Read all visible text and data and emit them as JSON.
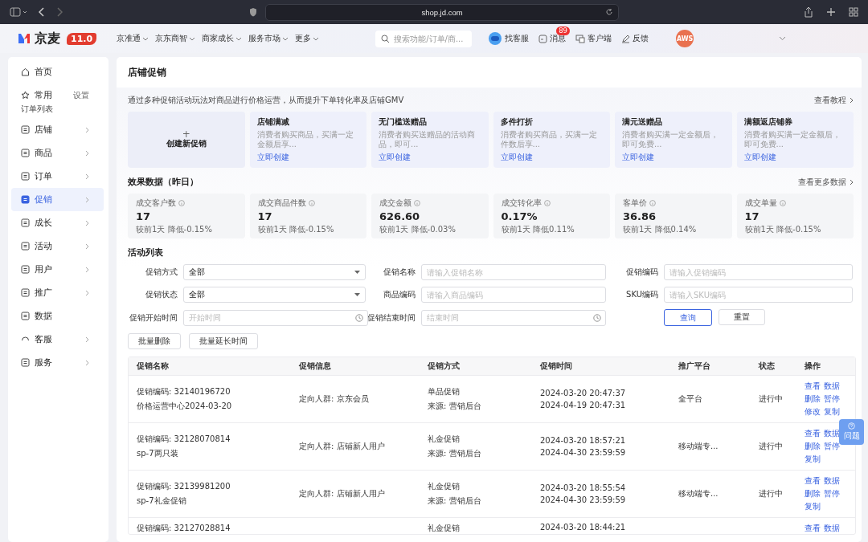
{
  "browser": {
    "url": "shop.jd.com"
  },
  "header": {
    "logo_text": "京麦",
    "version": "11.0",
    "nav": [
      "京准通",
      "京东商智",
      "商家成长",
      "服务市场",
      "更多"
    ],
    "search": {
      "placeholder": "搜索功能/订单/商..."
    },
    "tools": [
      {
        "kind": "service",
        "label": "找客服"
      },
      {
        "kind": "message",
        "label": "消息",
        "badge": "89"
      },
      {
        "kind": "client",
        "label": "客户端"
      },
      {
        "kind": "feedback",
        "label": "反馈"
      }
    ],
    "avatar_text": "AWS"
  },
  "sidebar": {
    "items": [
      {
        "kind": "home",
        "label": "首页",
        "selected": false
      },
      {
        "kind": "pinned",
        "label": "常用",
        "action": "设置",
        "selected": false
      },
      {
        "kind": "sub",
        "label": "订单列表",
        "selected": false
      },
      {
        "kind": "menu",
        "label": "店铺",
        "selected": false
      },
      {
        "kind": "menu",
        "label": "商品",
        "selected": false
      },
      {
        "kind": "menu",
        "label": "订单",
        "selected": false
      },
      {
        "kind": "menu",
        "label": "促销",
        "selected": true
      },
      {
        "kind": "menu",
        "label": "成长",
        "selected": false
      },
      {
        "kind": "menu",
        "label": "活动",
        "selected": false
      },
      {
        "kind": "menu",
        "label": "用户",
        "selected": false
      },
      {
        "kind": "menu",
        "label": "推广",
        "selected": false
      },
      {
        "kind": "page",
        "label": "数据",
        "selected": false
      },
      {
        "kind": "service",
        "label": "客服",
        "selected": false
      },
      {
        "kind": "menu",
        "label": "服务",
        "selected": false
      }
    ]
  },
  "page": {
    "title": "店铺促销",
    "intro": "通过多种促销活动玩法对商品进行价格运营，从而提升下单转化率及店铺GMV",
    "tutorial_link": "查看教程",
    "create_icon": "+",
    "create_label": "创建新促销",
    "promo_types": [
      {
        "title": "店铺满减",
        "desc": "消费者购买商品，买满一定金额后享...",
        "action": "立即创建"
      },
      {
        "title": "无门槛送赠品",
        "desc": "消费者购买送赠品的活动商品，即可...",
        "action": "立即创建"
      },
      {
        "title": "多件打折",
        "desc": "消费者购买商品，买满一定件数后享...",
        "action": "立即创建"
      },
      {
        "title": "满元送赠品",
        "desc": "消费者购买满一定金额后，即可免费...",
        "action": "立即创建"
      },
      {
        "title": "满额返店铺券",
        "desc": "消费者购买满一定金额后，即可免费...",
        "action": "立即创建"
      }
    ],
    "stats_title": "效果数据（昨日）",
    "stats_link": "查看更多数据",
    "stats": [
      {
        "label": "成交客户数",
        "value": "17",
        "compare": "较前1天 降低-0.15%"
      },
      {
        "label": "成交商品件数",
        "value": "17",
        "compare": "较前1天 降低-0.15%"
      },
      {
        "label": "成交金额",
        "value": "626.60",
        "compare": "较前1天 降低-0.03%"
      },
      {
        "label": "成交转化率",
        "value": "0.17%",
        "compare": "较前1天 降低0.11%"
      },
      {
        "label": "客单价",
        "value": "36.86",
        "compare": "较前1天 降低0.14%"
      },
      {
        "label": "成交单量",
        "value": "17",
        "compare": "较前1天 降低-0.15%"
      }
    ],
    "list_title": "活动列表",
    "filters": [
      {
        "kind": "select",
        "label": "促销方式",
        "value": "全部"
      },
      {
        "kind": "input",
        "label": "促销名称",
        "placeholder": "请输入促销名称"
      },
      {
        "kind": "input",
        "label": "促销编码",
        "placeholder": "请输入促销编码"
      },
      {
        "kind": "select",
        "label": "促销状态",
        "value": "全部"
      },
      {
        "kind": "input",
        "label": "商品编码",
        "placeholder": "请输入商品编码"
      },
      {
        "kind": "input",
        "label": "SKU编码",
        "placeholder": "请输入SKU编码"
      },
      {
        "kind": "date",
        "label": "促销开始时间",
        "placeholder": "开始时间"
      },
      {
        "kind": "date",
        "label": "促销结束时间",
        "placeholder": "结束时间"
      }
    ],
    "query_button": "查询",
    "reset_button": "重置",
    "batch_buttons": [
      "批量删除",
      "批量延长时间"
    ],
    "table": {
      "columns": [
        "促销名称",
        "促销信息",
        "促销方式",
        "促销时间",
        "推广平台",
        "状态",
        "操作"
      ],
      "rows": [
        {
          "name": [
            "促销编码: 32140196720",
            "价格运营中心2024-03-20"
          ],
          "info": "定向人群: 京东会员",
          "method": [
            "单品促销",
            "来源: 营销后台"
          ],
          "time": [
            "2024-03-20 20:47:37",
            "2024-04-19 20:47:31"
          ],
          "platform": "全平台",
          "status": "进行中",
          "actions": [
            "查看",
            "数据",
            "删除",
            "暂停",
            "修改",
            "复制"
          ]
        },
        {
          "name": [
            "促销编码: 32128070814",
            "sp-7两只装"
          ],
          "info": "定向人群: 店铺新人用户",
          "method": [
            "礼金促销",
            "来源: 营销后台"
          ],
          "time": [
            "2024-03-20 18:57:21",
            "2024-04-30 23:59:59"
          ],
          "platform": "移动端专...",
          "status": "进行中",
          "actions": [
            "查看",
            "数据",
            "删除",
            "暂停",
            "复制"
          ]
        },
        {
          "name": [
            "促销编码: 32139981200",
            "sp-7礼金促销"
          ],
          "info": "定向人群: 店铺新人用户",
          "method": [
            "礼金促销",
            "来源: 营销后台"
          ],
          "time": [
            "2024-03-20 18:55:54",
            "2024-04-30 23:59:59"
          ],
          "platform": "移动端专...",
          "status": "进行中",
          "actions": [
            "查看",
            "数据",
            "删除",
            "暂停",
            "复制"
          ]
        },
        {
          "name": [
            "促销编码: 32127028814"
          ],
          "method": [
            "礼金促销"
          ],
          "time": [
            "2024-03-20 18:44:21"
          ],
          "actions": [
            "查看",
            "数据"
          ]
        }
      ]
    }
  },
  "help_button": "问题"
}
